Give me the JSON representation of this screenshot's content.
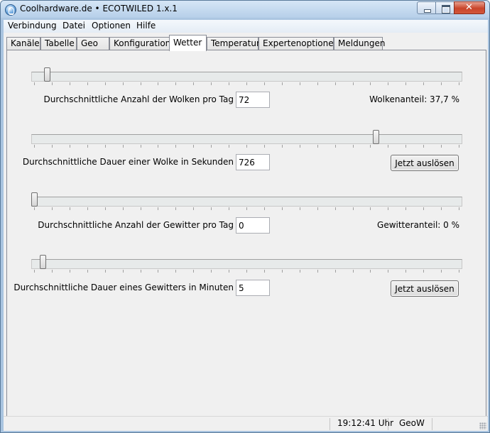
{
  "window": {
    "title": "Coolhardware.de • ECOTWILED 1.x.1"
  },
  "menu": {
    "items": [
      "Verbindung",
      "Datei",
      "Optionen",
      "Hilfe"
    ]
  },
  "tabs": [
    "Kanäle",
    "Tabelle",
    "Geo",
    "Konfiguration",
    "Wetter",
    "Temperatur",
    "Expertenoptionen",
    "Meldungen"
  ],
  "active_tab": "Wetter",
  "weather": {
    "clouds_per_day": {
      "label": "Durchschnittliche Anzahl der Wolken pro Tag",
      "value": "72",
      "slider_fraction": 0.03
    },
    "cloud_share": "Wolkenanteil: 37,7 %",
    "cloud_duration": {
      "label": "Durchschnittliche Dauer einer Wolke in Sekunden",
      "value": "726",
      "slider_fraction": 0.805
    },
    "trigger_cloud": "Jetzt auslösen",
    "storms_per_day": {
      "label": "Durchschnittliche Anzahl der Gewitter pro Tag",
      "value": "0",
      "slider_fraction": 0.0
    },
    "storm_share": "Gewitteranteil: 0 %",
    "storm_duration": {
      "label": "Durchschnittliche Dauer eines Gewitters in Minuten",
      "value": "5",
      "slider_fraction": 0.02
    },
    "trigger_storm": "Jetzt auslösen"
  },
  "status": {
    "time": "19:12:41 Uhr",
    "mode": "GeoW"
  }
}
